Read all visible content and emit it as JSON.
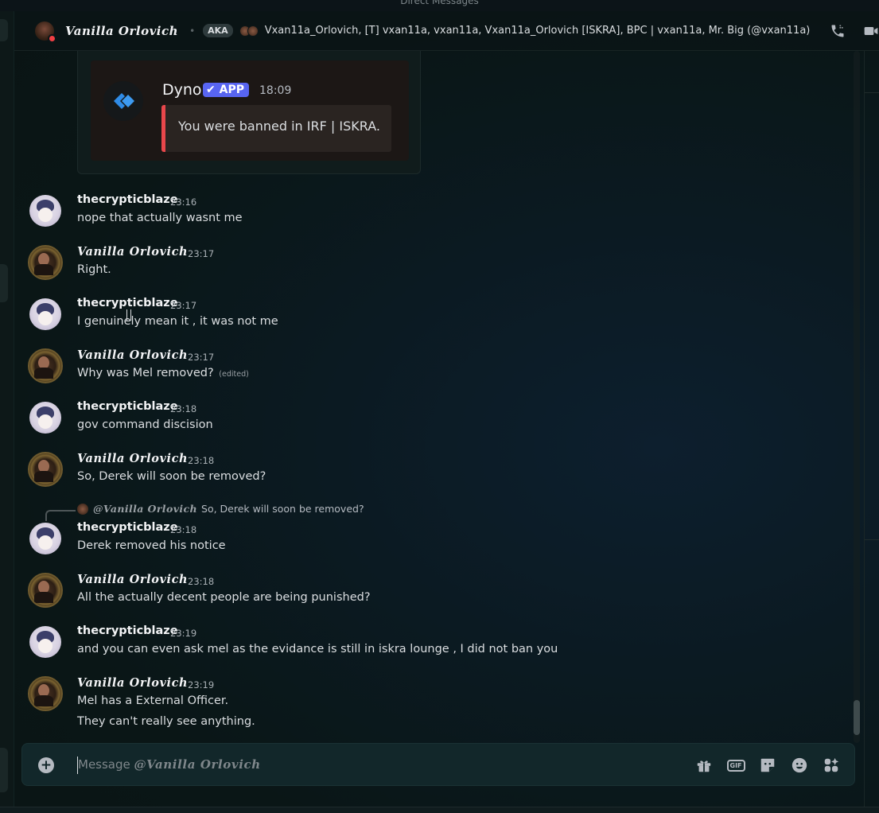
{
  "window": {
    "top_title": "Direct Messages"
  },
  "header": {
    "name": "Vanilla Orlovich",
    "aka_label": "AKA",
    "aka_names": "Vxan11a_Orlovich, [T] vxan11a, vxan11a, Vxan11a_Orlovich [ISKRA], BPC | vxan11a, Mr. Big (@vxan11a)"
  },
  "embed": {
    "author": "Dyno",
    "badge": "✔ APP",
    "time": "18:09",
    "text": "You were banned in IRF | ISKRA.",
    "accent_color": "#e8474b"
  },
  "messages": [
    {
      "author": "thecrypticblaze",
      "time": "23:16",
      "lines": [
        "nope that actually wasnt me"
      ]
    },
    {
      "author": "Vanilla Orlovich",
      "time": "23:17",
      "lines": [
        "Right."
      ]
    },
    {
      "author": "thecrypticblaze",
      "time": "23:17",
      "lines": [
        "I genuinely mean it , it was not me"
      ]
    },
    {
      "author": "Vanilla Orlovich",
      "time": "23:17",
      "lines": [
        "Why was Mel removed?"
      ],
      "edited": "(edited)"
    },
    {
      "author": "thecrypticblaze",
      "time": "23:18",
      "lines": [
        "gov command discision"
      ]
    },
    {
      "author": "Vanilla Orlovich",
      "time": "23:18",
      "lines": [
        "So, Derek will soon be removed?"
      ]
    },
    {
      "author": "thecrypticblaze",
      "time": "23:18",
      "lines": [
        "Derek removed his notice"
      ],
      "reply": {
        "mention": "@Vanilla Orlovich",
        "text": "So, Derek will soon be removed?"
      }
    },
    {
      "author": "Vanilla Orlovich",
      "time": "23:18",
      "lines": [
        "All the actually decent people are being punished?"
      ]
    },
    {
      "author": "thecrypticblaze",
      "time": "23:19",
      "lines": [
        "and you can even ask mel as the evidance is still in iskra lounge , I did not ban you"
      ]
    },
    {
      "author": "Vanilla Orlovich",
      "time": "23:19",
      "lines": [
        "Mel has a External Officer.",
        "They can't really see anything."
      ]
    }
  ],
  "composer": {
    "placeholder_prefix": "Message ",
    "placeholder_name": "@Vanilla Orlovich"
  },
  "icons": {
    "header": [
      "phone-call-icon",
      "video-call-icon"
    ],
    "composer": [
      "plus-icon",
      "gift-icon",
      "gif-icon",
      "sticker-icon",
      "emoji-icon",
      "apps-icon"
    ]
  },
  "colors": {
    "brand": "#5865f2",
    "dnd_status": "#f23f43",
    "ban_accent": "#e8474b"
  }
}
